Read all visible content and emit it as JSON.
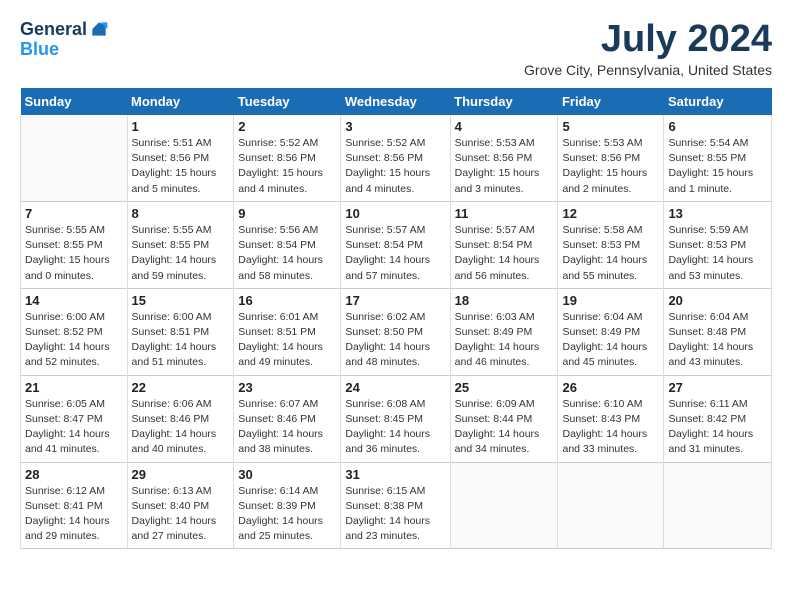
{
  "header": {
    "logo_general": "General",
    "logo_blue": "Blue",
    "month_year": "July 2024",
    "location": "Grove City, Pennsylvania, United States"
  },
  "days_of_week": [
    "Sunday",
    "Monday",
    "Tuesday",
    "Wednesday",
    "Thursday",
    "Friday",
    "Saturday"
  ],
  "weeks": [
    [
      {
        "day": "",
        "content": ""
      },
      {
        "day": "1",
        "content": "Sunrise: 5:51 AM\nSunset: 8:56 PM\nDaylight: 15 hours\nand 5 minutes."
      },
      {
        "day": "2",
        "content": "Sunrise: 5:52 AM\nSunset: 8:56 PM\nDaylight: 15 hours\nand 4 minutes."
      },
      {
        "day": "3",
        "content": "Sunrise: 5:52 AM\nSunset: 8:56 PM\nDaylight: 15 hours\nand 4 minutes."
      },
      {
        "day": "4",
        "content": "Sunrise: 5:53 AM\nSunset: 8:56 PM\nDaylight: 15 hours\nand 3 minutes."
      },
      {
        "day": "5",
        "content": "Sunrise: 5:53 AM\nSunset: 8:56 PM\nDaylight: 15 hours\nand 2 minutes."
      },
      {
        "day": "6",
        "content": "Sunrise: 5:54 AM\nSunset: 8:55 PM\nDaylight: 15 hours\nand 1 minute."
      }
    ],
    [
      {
        "day": "7",
        "content": "Sunrise: 5:55 AM\nSunset: 8:55 PM\nDaylight: 15 hours\nand 0 minutes."
      },
      {
        "day": "8",
        "content": "Sunrise: 5:55 AM\nSunset: 8:55 PM\nDaylight: 14 hours\nand 59 minutes."
      },
      {
        "day": "9",
        "content": "Sunrise: 5:56 AM\nSunset: 8:54 PM\nDaylight: 14 hours\nand 58 minutes."
      },
      {
        "day": "10",
        "content": "Sunrise: 5:57 AM\nSunset: 8:54 PM\nDaylight: 14 hours\nand 57 minutes."
      },
      {
        "day": "11",
        "content": "Sunrise: 5:57 AM\nSunset: 8:54 PM\nDaylight: 14 hours\nand 56 minutes."
      },
      {
        "day": "12",
        "content": "Sunrise: 5:58 AM\nSunset: 8:53 PM\nDaylight: 14 hours\nand 55 minutes."
      },
      {
        "day": "13",
        "content": "Sunrise: 5:59 AM\nSunset: 8:53 PM\nDaylight: 14 hours\nand 53 minutes."
      }
    ],
    [
      {
        "day": "14",
        "content": "Sunrise: 6:00 AM\nSunset: 8:52 PM\nDaylight: 14 hours\nand 52 minutes."
      },
      {
        "day": "15",
        "content": "Sunrise: 6:00 AM\nSunset: 8:51 PM\nDaylight: 14 hours\nand 51 minutes."
      },
      {
        "day": "16",
        "content": "Sunrise: 6:01 AM\nSunset: 8:51 PM\nDaylight: 14 hours\nand 49 minutes."
      },
      {
        "day": "17",
        "content": "Sunrise: 6:02 AM\nSunset: 8:50 PM\nDaylight: 14 hours\nand 48 minutes."
      },
      {
        "day": "18",
        "content": "Sunrise: 6:03 AM\nSunset: 8:49 PM\nDaylight: 14 hours\nand 46 minutes."
      },
      {
        "day": "19",
        "content": "Sunrise: 6:04 AM\nSunset: 8:49 PM\nDaylight: 14 hours\nand 45 minutes."
      },
      {
        "day": "20",
        "content": "Sunrise: 6:04 AM\nSunset: 8:48 PM\nDaylight: 14 hours\nand 43 minutes."
      }
    ],
    [
      {
        "day": "21",
        "content": "Sunrise: 6:05 AM\nSunset: 8:47 PM\nDaylight: 14 hours\nand 41 minutes."
      },
      {
        "day": "22",
        "content": "Sunrise: 6:06 AM\nSunset: 8:46 PM\nDaylight: 14 hours\nand 40 minutes."
      },
      {
        "day": "23",
        "content": "Sunrise: 6:07 AM\nSunset: 8:46 PM\nDaylight: 14 hours\nand 38 minutes."
      },
      {
        "day": "24",
        "content": "Sunrise: 6:08 AM\nSunset: 8:45 PM\nDaylight: 14 hours\nand 36 minutes."
      },
      {
        "day": "25",
        "content": "Sunrise: 6:09 AM\nSunset: 8:44 PM\nDaylight: 14 hours\nand 34 minutes."
      },
      {
        "day": "26",
        "content": "Sunrise: 6:10 AM\nSunset: 8:43 PM\nDaylight: 14 hours\nand 33 minutes."
      },
      {
        "day": "27",
        "content": "Sunrise: 6:11 AM\nSunset: 8:42 PM\nDaylight: 14 hours\nand 31 minutes."
      }
    ],
    [
      {
        "day": "28",
        "content": "Sunrise: 6:12 AM\nSunset: 8:41 PM\nDaylight: 14 hours\nand 29 minutes."
      },
      {
        "day": "29",
        "content": "Sunrise: 6:13 AM\nSunset: 8:40 PM\nDaylight: 14 hours\nand 27 minutes."
      },
      {
        "day": "30",
        "content": "Sunrise: 6:14 AM\nSunset: 8:39 PM\nDaylight: 14 hours\nand 25 minutes."
      },
      {
        "day": "31",
        "content": "Sunrise: 6:15 AM\nSunset: 8:38 PM\nDaylight: 14 hours\nand 23 minutes."
      },
      {
        "day": "",
        "content": ""
      },
      {
        "day": "",
        "content": ""
      },
      {
        "day": "",
        "content": ""
      }
    ]
  ]
}
